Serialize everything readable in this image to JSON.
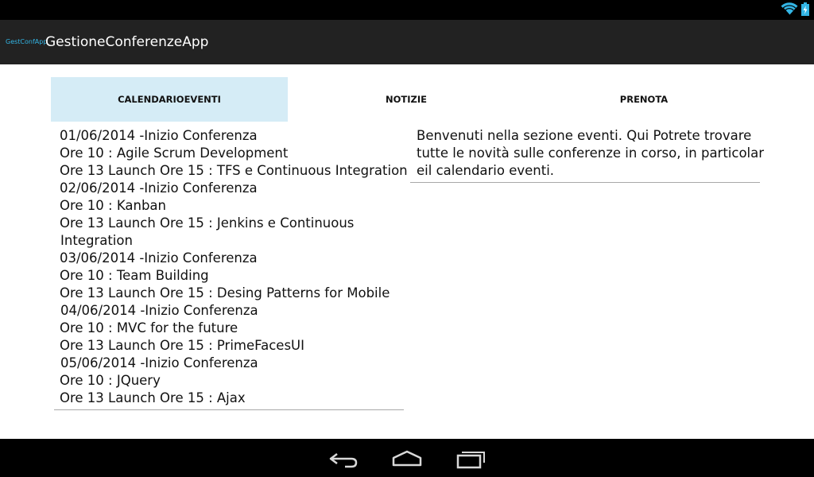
{
  "action_bar": {
    "logo_text": "GestConfApp",
    "title": "GestioneConferenzeApp"
  },
  "tabs": [
    {
      "label": "CALENDARIOEVENTI",
      "selected": true
    },
    {
      "label": "NOTIZIE",
      "selected": false
    },
    {
      "label": "PRENOTA",
      "selected": false
    }
  ],
  "events": [
    "01/06/2014 -Inizio Conferenza",
    " Ore 10 : Agile Scrum Development",
    " Ore 13 Launch Ore 15 : TFS e Continuous Integration",
    " 02/06/2014 -Inizio Conferenza",
    " Ore 10 : Kanban",
    " Ore 13 Launch Ore 15 : Jenkins e Continuous",
    "Integration",
    " 03/06/2014 -Inizio Conferenza",
    " Ore 10 : Team Building",
    " Ore 13 Launch Ore 15 : Desing Patterns for Mobile",
    "04/06/2014 -Inizio Conferenza",
    " Ore 10 : MVC for the future",
    " Ore 13 Launch Ore 15 : PrimeFacesUI",
    "05/06/2014 -Inizio Conferenza",
    " Ore 10 : JQuery",
    " Ore 13 Launch Ore 15 : Ajax"
  ],
  "welcome_lines": [
    "Benvenuti nella sezione eventi. Qui Potrete trovare",
    "tutte le novità sulle conferenze in corso, in particolar",
    "eil calendario eventi."
  ],
  "colors": {
    "accent": "#33b5e5",
    "tab_selected_bg": "#d5ecf6",
    "action_bar_bg": "#222222"
  }
}
